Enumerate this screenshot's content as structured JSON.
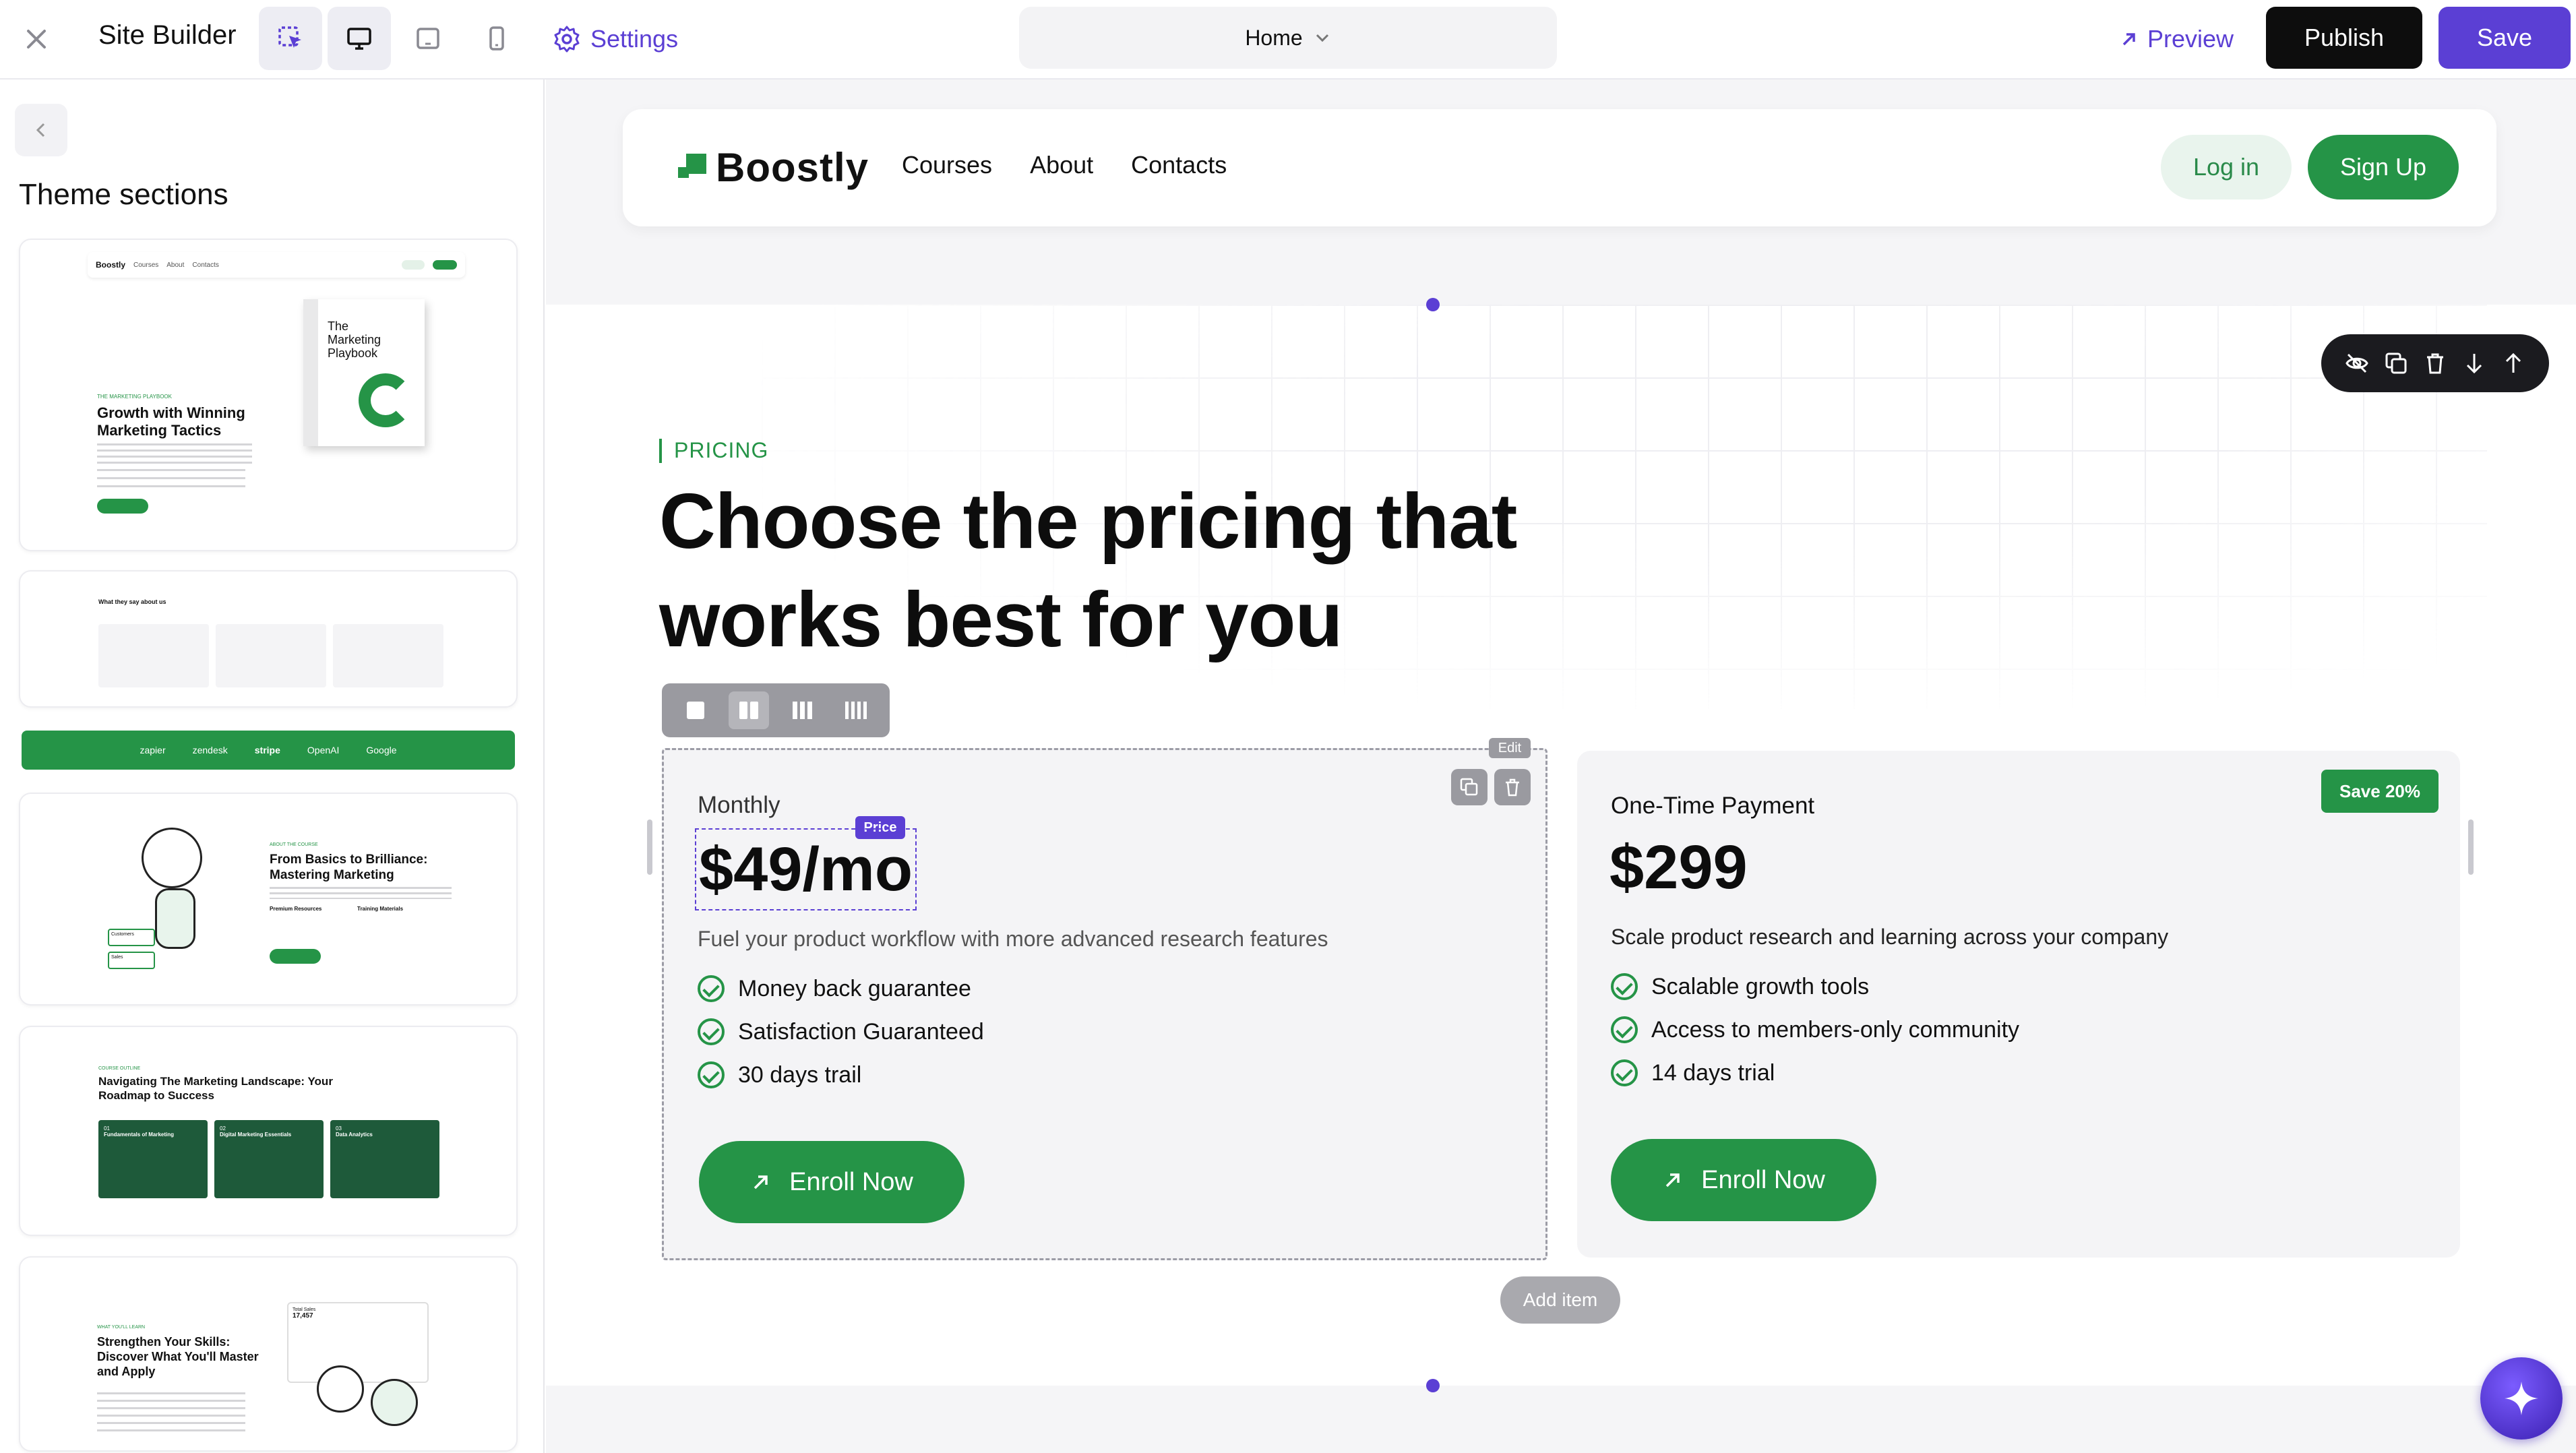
{
  "topbar": {
    "app_title": "Site Builder",
    "settings_label": "Settings",
    "page_select": "Home",
    "preview_label": "Preview",
    "publish_label": "Publish",
    "save_label": "Save"
  },
  "sidebar": {
    "heading": "Theme sections",
    "thumbs": {
      "hero": {
        "logo": "Boostly",
        "nav": [
          "Courses",
          "About",
          "Contacts"
        ],
        "kicker": "THE MARKETING PLAYBOOK",
        "title": "Growth with Winning Marketing Tactics",
        "book_title": "The Marketing Playbook"
      },
      "testimonials": {
        "title": "What they say about us"
      },
      "logos": [
        "zapier",
        "zendesk",
        "stripe",
        "OpenAI",
        "Google"
      ],
      "about": {
        "kicker": "ABOUT THE COURSE",
        "title": "From Basics to Brilliance: Mastering Marketing",
        "col1": "Premium Resources",
        "col2": "Training Materials",
        "stat1": "Customers",
        "stat2": "Sales"
      },
      "landscape": {
        "kicker": "COURSE OUTLINE",
        "title": "Navigating The Marketing Landscape: Your Roadmap to Success",
        "cards": [
          {
            "num": "01",
            "label": "Fundamentals of Marketing"
          },
          {
            "num": "02",
            "label": "Digital Marketing Essentials"
          },
          {
            "num": "03",
            "label": "Data Analytics"
          }
        ]
      },
      "skills": {
        "kicker": "WHAT YOU'LL LEARN",
        "title": "Strengthen Your Skills: Discover What You'll Master and Apply",
        "stat_label": "Total Sales",
        "stat_value": "17,457"
      }
    }
  },
  "site": {
    "logo": "Boostly",
    "nav": [
      "Courses",
      "About",
      "Contacts"
    ],
    "login_label": "Log in",
    "signup_label": "Sign Up"
  },
  "pricing": {
    "kicker": "PRICING",
    "heading_line1": "Choose the pricing that",
    "heading_line2": "works best for you",
    "edit_tag": "Edit",
    "price_tag": "Price",
    "add_item_label": "Add item",
    "cards": [
      {
        "plan": "Monthly",
        "price": "$49/mo",
        "desc": "Fuel your product workflow with more advanced research features",
        "features": [
          "Money back guarantee",
          "Satisfaction Guaranteed",
          "30 days trail"
        ],
        "cta": "Enroll Now"
      },
      {
        "plan": "One-Time Payment",
        "badge": "Save 20%",
        "price": "$299",
        "desc": "Scale product research and learning across your company",
        "features": [
          "Scalable growth tools",
          "Access to members-only community",
          "14 days trial"
        ],
        "cta": "Enroll Now"
      }
    ]
  },
  "colors": {
    "brand_green": "#259447",
    "accent_purple": "#5b3fd4",
    "dark": "#111111"
  },
  "icons": [
    "close-icon",
    "select-icon",
    "desktop-icon",
    "tablet-icon",
    "mobile-icon",
    "gear-icon",
    "chevron-down-icon",
    "arrow-up-right-icon",
    "chevron-left-icon",
    "hide-icon",
    "duplicate-icon",
    "trash-icon",
    "arrow-down-icon",
    "arrow-up-icon",
    "sparkle-icon",
    "check-circle-icon"
  ]
}
